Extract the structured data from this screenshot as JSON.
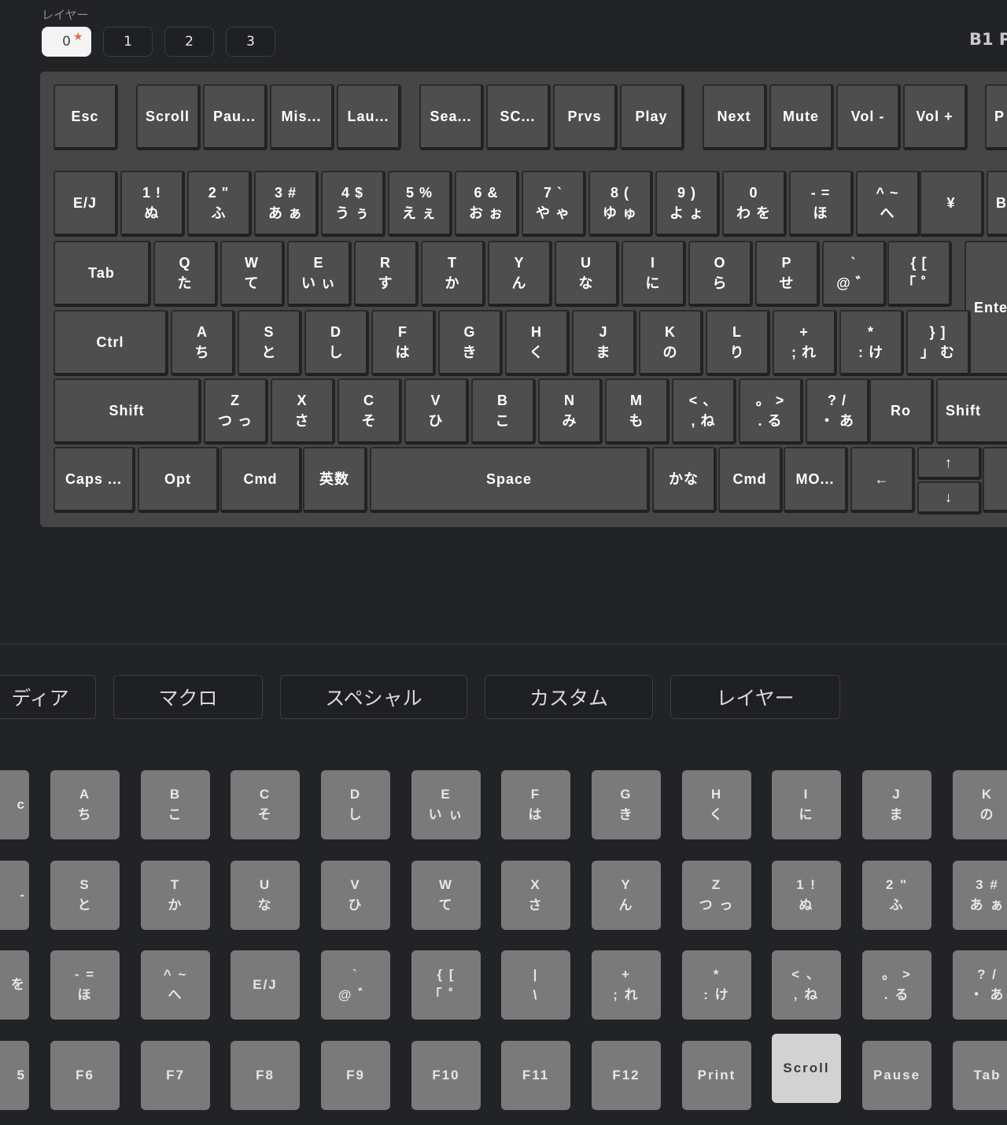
{
  "layer_selector": {
    "label": "レイヤー",
    "tabs": [
      {
        "label": "0",
        "active": true,
        "star": "★"
      },
      {
        "label": "1"
      },
      {
        "label": "2"
      },
      {
        "label": "3"
      }
    ]
  },
  "keyboard_title": "B1 P",
  "keyboard": {
    "rows": [
      [
        {
          "id": "esc",
          "l1": "Esc"
        },
        {
          "id": "scroll",
          "l1": "Scroll"
        },
        {
          "id": "pause",
          "l1": "Pau..."
        },
        {
          "id": "mission",
          "l1": "Mis..."
        },
        {
          "id": "launchpad",
          "l1": "Lau..."
        },
        {
          "id": "search",
          "l1": "Sea..."
        },
        {
          "id": "screenshot",
          "l1": "SC..."
        },
        {
          "id": "prev",
          "l1": "Prvs"
        },
        {
          "id": "play",
          "l1": "Play"
        },
        {
          "id": "next",
          "l1": "Next"
        },
        {
          "id": "mute",
          "l1": "Mute"
        },
        {
          "id": "vol-down",
          "l1": "Vol -"
        },
        {
          "id": "vol-up",
          "l1": "Vol +"
        },
        {
          "id": "extra-f",
          "l1": "P"
        }
      ],
      [
        {
          "id": "ej",
          "l1": "E/J"
        },
        {
          "id": "1",
          "l1": "1 !",
          "l2": "ぬ"
        },
        {
          "id": "2",
          "l1": "2 \"",
          "l2": "ふ"
        },
        {
          "id": "3",
          "l1": "3 #",
          "l2": "あ ぁ"
        },
        {
          "id": "4",
          "l1": "4 $",
          "l2": "う ぅ"
        },
        {
          "id": "5",
          "l1": "5 %",
          "l2": "え ぇ"
        },
        {
          "id": "6",
          "l1": "6 &",
          "l2": "お ぉ"
        },
        {
          "id": "7",
          "l1": "7 `",
          "l2": "や ゃ"
        },
        {
          "id": "8",
          "l1": "8 (",
          "l2": "ゆ ゅ"
        },
        {
          "id": "9",
          "l1": "9 )",
          "l2": "よ ょ"
        },
        {
          "id": "0",
          "l1": "0",
          "l2": "わ を"
        },
        {
          "id": "minus",
          "l1": "- =",
          "l2": "ほ"
        },
        {
          "id": "caret",
          "l1": "^ ~",
          "l2": "へ"
        },
        {
          "id": "yen",
          "l1": "¥"
        },
        {
          "id": "backspace",
          "l1": "Ba"
        }
      ],
      [
        {
          "id": "tab",
          "l1": "Tab"
        },
        {
          "id": "q",
          "l1": "Q",
          "l2": "た"
        },
        {
          "id": "w",
          "l1": "W",
          "l2": "て"
        },
        {
          "id": "e",
          "l1": "E",
          "l2": "い ぃ"
        },
        {
          "id": "r",
          "l1": "R",
          "l2": "す"
        },
        {
          "id": "t",
          "l1": "T",
          "l2": "か"
        },
        {
          "id": "y",
          "l1": "Y",
          "l2": "ん"
        },
        {
          "id": "u",
          "l1": "U",
          "l2": "な"
        },
        {
          "id": "i",
          "l1": "I",
          "l2": "に"
        },
        {
          "id": "o",
          "l1": "O",
          "l2": "ら"
        },
        {
          "id": "p",
          "l1": "P",
          "l2": "せ"
        },
        {
          "id": "at",
          "l1": "`",
          "l2": "@ ゛"
        },
        {
          "id": "bracket-open",
          "l1": "{ [",
          "l2": "「 ゜"
        },
        {
          "id": "enter",
          "l1": "Ente"
        }
      ],
      [
        {
          "id": "ctrl",
          "l1": "Ctrl"
        },
        {
          "id": "a",
          "l1": "A",
          "l2": "ち"
        },
        {
          "id": "s",
          "l1": "S",
          "l2": "と"
        },
        {
          "id": "d",
          "l1": "D",
          "l2": "し"
        },
        {
          "id": "f",
          "l1": "F",
          "l2": "は"
        },
        {
          "id": "g",
          "l1": "G",
          "l2": "き"
        },
        {
          "id": "h",
          "l1": "H",
          "l2": "く"
        },
        {
          "id": "j",
          "l1": "J",
          "l2": "ま"
        },
        {
          "id": "k",
          "l1": "K",
          "l2": "の"
        },
        {
          "id": "l",
          "l1": "L",
          "l2": "り"
        },
        {
          "id": "semicolon",
          "l1": "+",
          "l2": "; れ"
        },
        {
          "id": "colon",
          "l1": "*",
          "l2": ": け"
        },
        {
          "id": "bracket-close",
          "l1": "} ]",
          "l2": "」 む"
        }
      ],
      [
        {
          "id": "shift-left",
          "l1": "Shift"
        },
        {
          "id": "z",
          "l1": "Z",
          "l2": "つ っ"
        },
        {
          "id": "x",
          "l1": "X",
          "l2": "さ"
        },
        {
          "id": "c",
          "l1": "C",
          "l2": "そ"
        },
        {
          "id": "v",
          "l1": "V",
          "l2": "ひ"
        },
        {
          "id": "b",
          "l1": "B",
          "l2": "こ"
        },
        {
          "id": "n",
          "l1": "N",
          "l2": "み"
        },
        {
          "id": "m",
          "l1": "M",
          "l2": "も"
        },
        {
          "id": "comma",
          "l1": "< 、",
          "l2": ", ね"
        },
        {
          "id": "period",
          "l1": "。 >",
          "l2": ". る"
        },
        {
          "id": "slash",
          "l1": "? /",
          "l2": "・ あ"
        },
        {
          "id": "ro",
          "l1": "Ro"
        },
        {
          "id": "shift-right",
          "l1": "Shift"
        }
      ],
      [
        {
          "id": "caps",
          "l1": "Caps ..."
        },
        {
          "id": "opt",
          "l1": "Opt"
        },
        {
          "id": "cmd-left",
          "l1": "Cmd"
        },
        {
          "id": "eisu",
          "l1": "英数"
        },
        {
          "id": "space",
          "l1": "Space"
        },
        {
          "id": "kana",
          "l1": "かな"
        },
        {
          "id": "cmd-right",
          "l1": "Cmd"
        },
        {
          "id": "mo",
          "l1": "MO..."
        },
        {
          "id": "left",
          "l1": "←"
        },
        {
          "id": "up",
          "l1": "↑"
        },
        {
          "id": "down",
          "l1": "↓"
        },
        {
          "id": "right",
          "l1": ""
        }
      ]
    ]
  },
  "category_tabs": [
    "ディア",
    "マクロ",
    "スペシャル",
    "カスタム",
    "レイヤー"
  ],
  "palette": {
    "selected": "Scroll",
    "rows": [
      [
        {
          "l1": "c"
        },
        {
          "l1": "A",
          "l2": "ち"
        },
        {
          "l1": "B",
          "l2": "こ"
        },
        {
          "l1": "C",
          "l2": "そ"
        },
        {
          "l1": "D",
          "l2": "し"
        },
        {
          "l1": "E",
          "l2": "い ぃ"
        },
        {
          "l1": "F",
          "l2": "は"
        },
        {
          "l1": "G",
          "l2": "き"
        },
        {
          "l1": "H",
          "l2": "く"
        },
        {
          "l1": "I",
          "l2": "に"
        },
        {
          "l1": "J",
          "l2": "ま"
        },
        {
          "l1": "K",
          "l2": "の"
        }
      ],
      [
        {
          "l1": "",
          "l2": "-"
        },
        {
          "l1": "S",
          "l2": "と"
        },
        {
          "l1": "T",
          "l2": "か"
        },
        {
          "l1": "U",
          "l2": "な"
        },
        {
          "l1": "V",
          "l2": "ひ"
        },
        {
          "l1": "W",
          "l2": "て"
        },
        {
          "l1": "X",
          "l2": "さ"
        },
        {
          "l1": "Y",
          "l2": "ん"
        },
        {
          "l1": "Z",
          "l2": "つ っ"
        },
        {
          "l1": "1 !",
          "l2": "ぬ"
        },
        {
          "l1": "2 \"",
          "l2": "ふ"
        },
        {
          "l1": "3 #",
          "l2": "あ ぁ"
        }
      ],
      [
        {
          "l1": "",
          "l2": "を"
        },
        {
          "l1": "- =",
          "l2": "ほ"
        },
        {
          "l1": "^ ~",
          "l2": "へ"
        },
        {
          "l1": "E/J"
        },
        {
          "l1": "`",
          "l2": "@ ゛"
        },
        {
          "l1": "{ [",
          "l2": "「 ゜"
        },
        {
          "l1": "|",
          "l2": "\\"
        },
        {
          "l1": "+",
          "l2": "; れ"
        },
        {
          "l1": "*",
          "l2": ": け"
        },
        {
          "l1": "< 、",
          "l2": ", ね"
        },
        {
          "l1": "。 >",
          "l2": ". る"
        },
        {
          "l1": "? /",
          "l2": "・ あ"
        }
      ],
      [
        {
          "l1": "5"
        },
        {
          "l1": "F6"
        },
        {
          "l1": "F7"
        },
        {
          "l1": "F8"
        },
        {
          "l1": "F9"
        },
        {
          "l1": "F10"
        },
        {
          "l1": "F11"
        },
        {
          "l1": "F12"
        },
        {
          "l1": "Print"
        },
        {
          "l1": "Scroll",
          "selected": true
        },
        {
          "l1": "Pause"
        },
        {
          "l1": "Tab"
        }
      ]
    ]
  },
  "colors": {
    "background": "#222326",
    "keyboard_case": "#464646",
    "key": "#4e4e4e",
    "palette_key": "#7a7a7a",
    "palette_key_selected": "#d2d2d2",
    "accent": "#e0703a"
  }
}
